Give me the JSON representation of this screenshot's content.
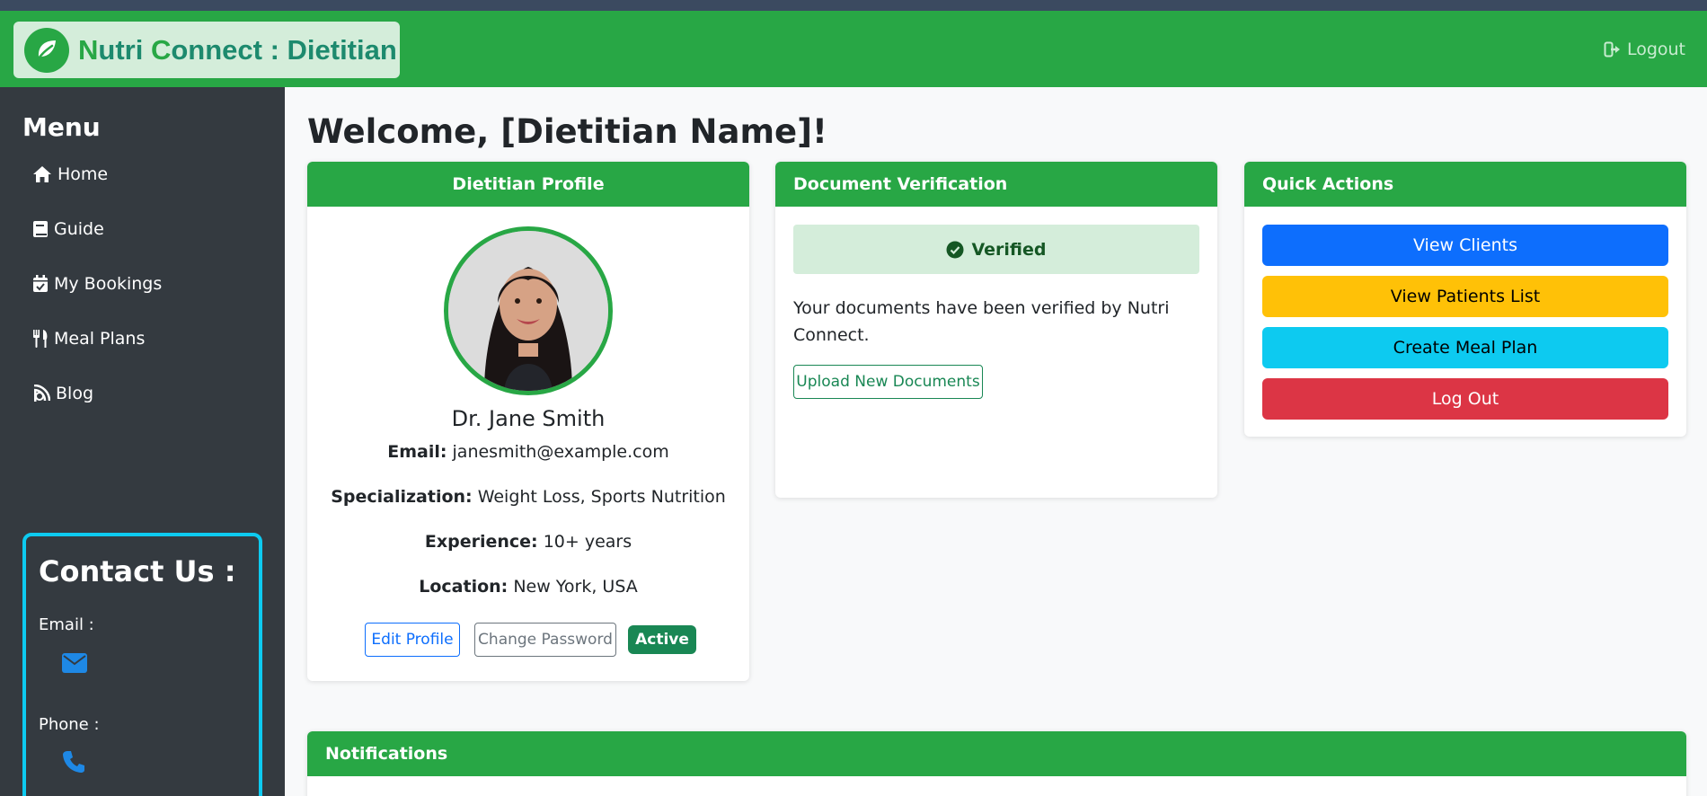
{
  "navbar": {
    "brand_first": "N",
    "brand_part1": "utri ",
    "brand_c": "C",
    "brand_part2": "onnect : Dietitian",
    "logout_label": "Logout"
  },
  "sidebar": {
    "title": "Menu",
    "items": [
      {
        "label": "Home",
        "icon": "home-icon"
      },
      {
        "label": "Guide",
        "icon": "book-icon"
      },
      {
        "label": "My Bookings",
        "icon": "calendar-check-icon"
      },
      {
        "label": "Meal Plans",
        "icon": "utensils-icon"
      },
      {
        "label": "Blog",
        "icon": "blog-icon"
      }
    ],
    "contact": {
      "title": "Contact Us :",
      "email_label": "Email :",
      "phone_label": "Phone :"
    }
  },
  "main": {
    "welcome": "Welcome, [Dietitian Name]!",
    "profile": {
      "header": "Dietitian Profile",
      "name": "Dr. Jane Smith",
      "email_label": "Email:",
      "email": "janesmith@example.com",
      "specialization_label": "Specialization:",
      "specialization": "Weight Loss, Sports Nutrition",
      "experience_label": "Experience:",
      "experience": "10+ years",
      "location_label": "Location:",
      "location": "New York, USA",
      "edit_label": "Edit Profile",
      "change_password_label": "Change Password",
      "status_badge": "Active"
    },
    "documents": {
      "header": "Document Verification",
      "status": "Verified",
      "message": "Your documents have been verified by Nutri Connect.",
      "upload_label": "Upload New Documents"
    },
    "quick_actions": {
      "header": "Quick Actions",
      "buttons": [
        {
          "label": "View Clients",
          "color": "#0d6efd"
        },
        {
          "label": "View Patients List",
          "color": "#ffc107"
        },
        {
          "label": "Create Meal Plan",
          "color": "#0dcaf0"
        },
        {
          "label": "Log Out",
          "color": "#dc3545"
        }
      ]
    },
    "notifications": {
      "header": "Notifications"
    }
  },
  "colors": {
    "primary_green": "#28a745",
    "sidebar_bg": "#343a40",
    "accent_cyan": "#0dcaf0"
  }
}
